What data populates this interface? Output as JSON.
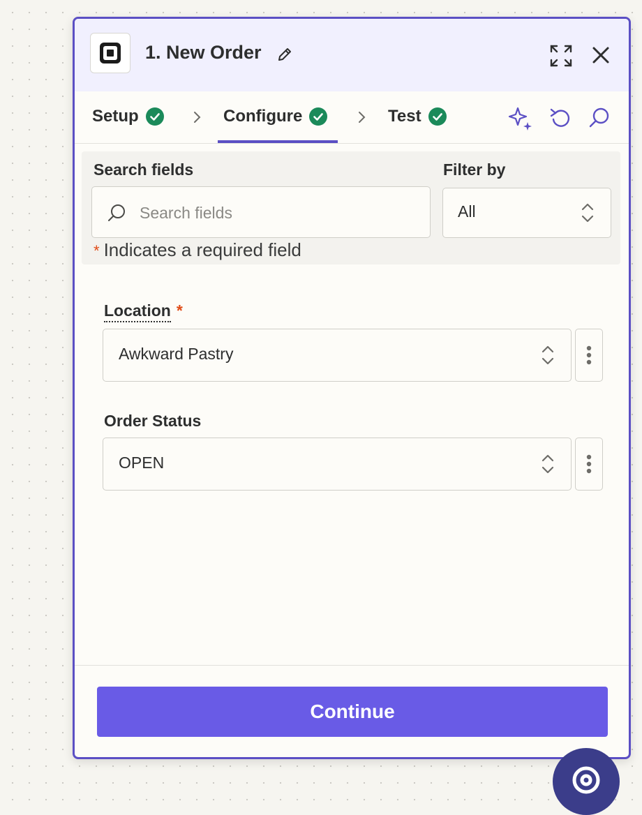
{
  "header": {
    "title": "1. New Order",
    "app_icon": "square-app-icon",
    "edit_icon": "pencil-icon",
    "expand_icon": "expand-icon",
    "close_icon": "close-icon",
    "background": "#f1f0fe"
  },
  "steps": {
    "items": [
      {
        "label": "Setup",
        "status": "complete"
      },
      {
        "label": "Configure",
        "status": "complete",
        "active": true
      },
      {
        "label": "Test",
        "status": "complete"
      }
    ],
    "tools": [
      "sparkle-ai-icon",
      "undo-icon",
      "search-icon"
    ]
  },
  "filters": {
    "search_label": "Search fields",
    "search_placeholder": "Search fields",
    "search_value": "",
    "filter_label": "Filter by",
    "filter_value": "All",
    "required_marker": "*",
    "required_note": "Indicates a required field"
  },
  "fields": {
    "location": {
      "label": "Location",
      "required_marker": "*",
      "value": "Awkward Pastry"
    },
    "order_status": {
      "label": "Order Status",
      "value": "OPEN"
    }
  },
  "footer": {
    "continue_label": "Continue"
  },
  "colors": {
    "accent": "#5b4fc4",
    "button": "#695be6",
    "success": "#1b8a5a",
    "required": "#e04b17",
    "canvas": "#f6f5f0"
  }
}
